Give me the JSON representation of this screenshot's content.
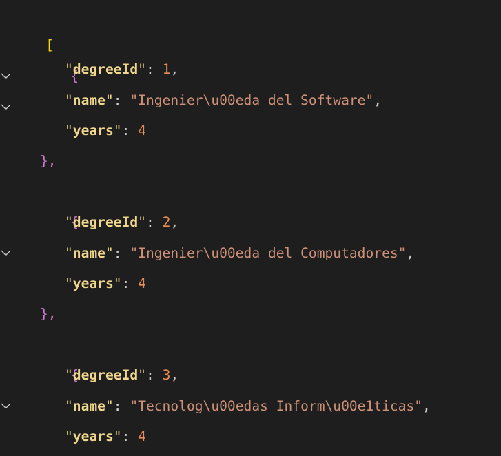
{
  "json": {
    "open_array": "[",
    "close_array": "]",
    "open_object": "{",
    "close_object": "}",
    "close_object_comma": "},",
    "colon": ": ",
    "comma": ",",
    "quote": "\"",
    "keys": {
      "degree_id": "degreeId",
      "name": "name",
      "years": "years"
    },
    "items": [
      {
        "degreeId": "1",
        "name": "\"Ingenier\\u00eda del Software\"",
        "years": "4"
      },
      {
        "degreeId": "2",
        "name": "\"Ingenier\\u00eda del Computadores\"",
        "years": "4"
      },
      {
        "degreeId": "3",
        "name": "\"Tecnolog\\u00edas Inform\\u00e1ticas\"",
        "years": "4"
      }
    ]
  },
  "icons": {
    "fold": "chevron-down-icon"
  },
  "colors": {
    "background": "#1e1e1e",
    "key": "#f0d78c",
    "string": "#ce9178",
    "number": "#e98d54",
    "punctuation": "#d4d4d4",
    "array_bracket": "#ffd700",
    "object_brace": "#cc78cc"
  }
}
